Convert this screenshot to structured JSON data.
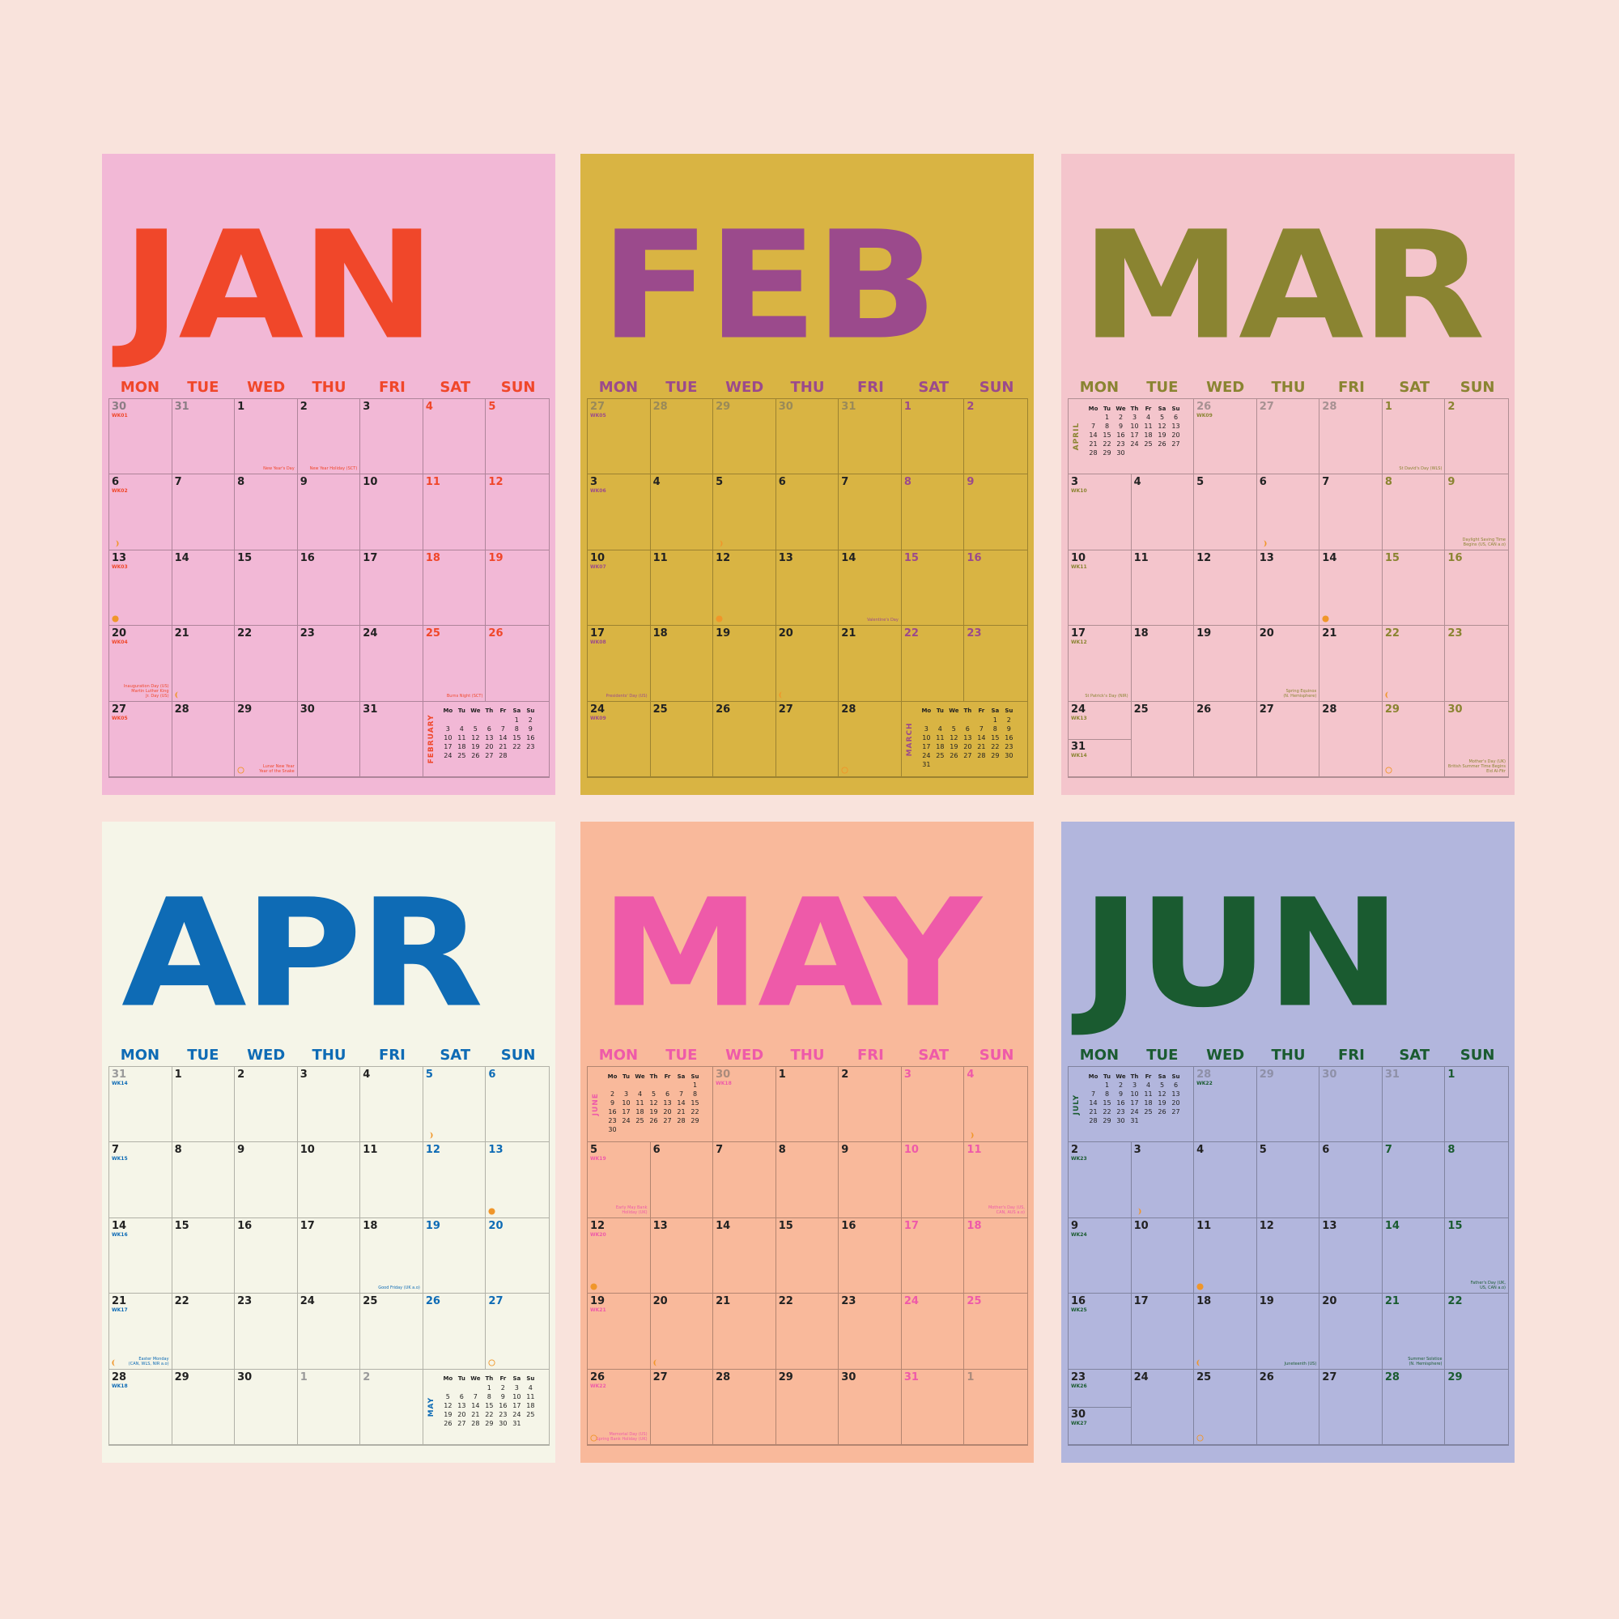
{
  "dow": [
    "MON",
    "TUE",
    "WED",
    "THU",
    "FRI",
    "SAT",
    "SUN"
  ],
  "mini_dow": [
    "Mo",
    "Tu",
    "We",
    "Th",
    "Fr",
    "Sa",
    "Su"
  ],
  "colors": {
    "background": "#f9e3dc",
    "moon": "#f0962a"
  },
  "months": [
    {
      "title": "JAN",
      "bg": "#f2b8d6",
      "accent": "#f0472a",
      "dim": "#8c7d85",
      "cells": [
        {
          "n": "30",
          "dim": true,
          "wk": "WK01"
        },
        {
          "n": "31",
          "dim": true
        },
        {
          "n": "1",
          "note": "New Year's Day"
        },
        {
          "n": "2",
          "note": "New Year Holiday (SCT)"
        },
        {
          "n": "3"
        },
        {
          "n": "4",
          "we": true
        },
        {
          "n": "5",
          "we": true
        },
        {
          "n": "6",
          "wk": "WK02",
          "moon": "first"
        },
        {
          "n": "7"
        },
        {
          "n": "8"
        },
        {
          "n": "9"
        },
        {
          "n": "10"
        },
        {
          "n": "11",
          "we": true
        },
        {
          "n": "12",
          "we": true
        },
        {
          "n": "13",
          "wk": "WK03",
          "moon": "full"
        },
        {
          "n": "14"
        },
        {
          "n": "15"
        },
        {
          "n": "16"
        },
        {
          "n": "17"
        },
        {
          "n": "18",
          "we": true
        },
        {
          "n": "19",
          "we": true
        },
        {
          "n": "20",
          "wk": "WK04",
          "note": "Inauguration Day (US)\nMartin Luther King\nJr. Day (US)"
        },
        {
          "n": "21",
          "moon": "last"
        },
        {
          "n": "22"
        },
        {
          "n": "23"
        },
        {
          "n": "24"
        },
        {
          "n": "25",
          "we": true,
          "note": "Burns Night (SCT)"
        },
        {
          "n": "26",
          "we": true
        },
        {
          "n": "27",
          "wk": "WK05"
        },
        {
          "n": "28"
        },
        {
          "n": "29",
          "moon": "new",
          "note": "Lunar New Year\nYear of the Snake"
        },
        {
          "n": "30"
        },
        {
          "n": "31"
        },
        {
          "mini": 1,
          "span": 2
        }
      ],
      "mini": {
        "name": "FEBRUARY",
        "rows": [
          [
            "",
            "",
            "",
            "",
            "",
            "1",
            "2"
          ],
          [
            "3",
            "4",
            "5",
            "6",
            "7",
            "8",
            "9"
          ],
          [
            "10",
            "11",
            "12",
            "13",
            "14",
            "15",
            "16"
          ],
          [
            "17",
            "18",
            "19",
            "20",
            "21",
            "22",
            "23"
          ],
          [
            "24",
            "25",
            "26",
            "27",
            "28",
            "",
            ""
          ]
        ]
      }
    },
    {
      "title": "FEB",
      "bg": "#d9b443",
      "accent": "#9b4a8c",
      "dim": "#9a8a58",
      "cells": [
        {
          "n": "27",
          "dim": true,
          "wk": "WK05"
        },
        {
          "n": "28",
          "dim": true
        },
        {
          "n": "29",
          "dim": true
        },
        {
          "n": "30",
          "dim": true
        },
        {
          "n": "31",
          "dim": true
        },
        {
          "n": "1",
          "we": true
        },
        {
          "n": "2",
          "we": true
        },
        {
          "n": "3",
          "wk": "WK06"
        },
        {
          "n": "4"
        },
        {
          "n": "5",
          "moon": "first"
        },
        {
          "n": "6"
        },
        {
          "n": "7"
        },
        {
          "n": "8",
          "we": true
        },
        {
          "n": "9",
          "we": true
        },
        {
          "n": "10",
          "wk": "WK07"
        },
        {
          "n": "11"
        },
        {
          "n": "12",
          "moon": "full"
        },
        {
          "n": "13"
        },
        {
          "n": "14",
          "note": "Valentine's Day"
        },
        {
          "n": "15",
          "we": true
        },
        {
          "n": "16",
          "we": true
        },
        {
          "n": "17",
          "wk": "WK08",
          "note": "Presidents' Day (US)"
        },
        {
          "n": "18"
        },
        {
          "n": "19"
        },
        {
          "n": "20",
          "moon": "last"
        },
        {
          "n": "21"
        },
        {
          "n": "22",
          "we": true
        },
        {
          "n": "23",
          "we": true
        },
        {
          "n": "24",
          "wk": "WK09"
        },
        {
          "n": "25"
        },
        {
          "n": "26"
        },
        {
          "n": "27"
        },
        {
          "n": "28",
          "moon": "new"
        },
        {
          "mini": 1,
          "span": 2
        }
      ],
      "mini": {
        "name": "MARCH",
        "rows": [
          [
            "",
            "",
            "",
            "",
            "",
            "1",
            "2"
          ],
          [
            "3",
            "4",
            "5",
            "6",
            "7",
            "8",
            "9"
          ],
          [
            "10",
            "11",
            "12",
            "13",
            "14",
            "15",
            "16"
          ],
          [
            "17",
            "18",
            "19",
            "20",
            "21",
            "22",
            "23"
          ],
          [
            "24",
            "25",
            "26",
            "27",
            "28",
            "29",
            "30"
          ],
          [
            "31",
            "",
            "",
            "",
            "",
            "",
            ""
          ]
        ]
      }
    },
    {
      "title": "MAR",
      "bg": "#f4c5cc",
      "accent": "#8a8431",
      "dim": "#a79192",
      "cells": [
        {
          "mini": 1,
          "span": 2
        },
        {
          "n": "26",
          "dim": true,
          "wk": "WK09"
        },
        {
          "n": "27",
          "dim": true
        },
        {
          "n": "28",
          "dim": true
        },
        {
          "n": "1",
          "we": true,
          "note": "St David's Day (WLS)"
        },
        {
          "n": "2",
          "we": true
        },
        {
          "n": "3",
          "wk": "WK10"
        },
        {
          "n": "4"
        },
        {
          "n": "5"
        },
        {
          "n": "6",
          "moon": "first"
        },
        {
          "n": "7"
        },
        {
          "n": "8",
          "we": true
        },
        {
          "n": "9",
          "we": true,
          "note": "Daylight Saving Time\nBegins (US, CAN a.o)"
        },
        {
          "n": "10",
          "wk": "WK11"
        },
        {
          "n": "11"
        },
        {
          "n": "12"
        },
        {
          "n": "13"
        },
        {
          "n": "14",
          "moon": "full"
        },
        {
          "n": "15",
          "we": true
        },
        {
          "n": "16",
          "we": true
        },
        {
          "n": "17",
          "wk": "WK12",
          "note": "St Patrick's Day (NIR)"
        },
        {
          "n": "18"
        },
        {
          "n": "19"
        },
        {
          "n": "20",
          "note": "Spring Equinox\n(N. Hemisphere)"
        },
        {
          "n": "21"
        },
        {
          "n": "22",
          "we": true,
          "moon": "last"
        },
        {
          "n": "23",
          "we": true
        },
        {
          "n": "24",
          "wk": "WK13",
          "split": {
            "n": "31",
            "wk": "WK14"
          }
        },
        {
          "n": "25"
        },
        {
          "n": "26"
        },
        {
          "n": "27"
        },
        {
          "n": "28"
        },
        {
          "n": "29",
          "we": true,
          "moon": "new"
        },
        {
          "n": "30",
          "we": true,
          "note": "Mother's Day (UK)\nBritish Summer Time Begins\nEid Al-Fitr"
        }
      ],
      "mini": {
        "name": "APRIL",
        "rows": [
          [
            "",
            "1",
            "2",
            "3",
            "4",
            "5",
            "6"
          ],
          [
            "7",
            "8",
            "9",
            "10",
            "11",
            "12",
            "13"
          ],
          [
            "14",
            "15",
            "16",
            "17",
            "18",
            "19",
            "20"
          ],
          [
            "21",
            "22",
            "23",
            "24",
            "25",
            "26",
            "27"
          ],
          [
            "28",
            "29",
            "30",
            "",
            "",
            "",
            ""
          ]
        ]
      }
    },
    {
      "title": "APR",
      "bg": "#f5f5e8",
      "accent": "#0e6bb5",
      "dim": "#9a9a9a",
      "cells": [
        {
          "n": "31",
          "dim": true,
          "wk": "WK14"
        },
        {
          "n": "1"
        },
        {
          "n": "2"
        },
        {
          "n": "3"
        },
        {
          "n": "4"
        },
        {
          "n": "5",
          "we": true,
          "moon": "first"
        },
        {
          "n": "6",
          "we": true
        },
        {
          "n": "7",
          "wk": "WK15"
        },
        {
          "n": "8"
        },
        {
          "n": "9"
        },
        {
          "n": "10"
        },
        {
          "n": "11"
        },
        {
          "n": "12",
          "we": true
        },
        {
          "n": "13",
          "we": true,
          "moon": "full"
        },
        {
          "n": "14",
          "wk": "WK16"
        },
        {
          "n": "15"
        },
        {
          "n": "16"
        },
        {
          "n": "17"
        },
        {
          "n": "18",
          "note": "Good Friday (UK a.o)"
        },
        {
          "n": "19",
          "we": true
        },
        {
          "n": "20",
          "we": true
        },
        {
          "n": "21",
          "wk": "WK17",
          "moon": "last",
          "note": "Easter Monday\n(CAN, WLS, NIR a.o)"
        },
        {
          "n": "22"
        },
        {
          "n": "23"
        },
        {
          "n": "24"
        },
        {
          "n": "25"
        },
        {
          "n": "26",
          "we": true
        },
        {
          "n": "27",
          "we": true,
          "moon": "new"
        },
        {
          "n": "28",
          "wk": "WK18"
        },
        {
          "n": "29"
        },
        {
          "n": "30"
        },
        {
          "n": "1",
          "dim": true
        },
        {
          "n": "2",
          "dim": true
        },
        {
          "mini": 1,
          "span": 2
        }
      ],
      "mini": {
        "name": "MAY",
        "rows": [
          [
            "",
            "",
            "",
            "1",
            "2",
            "3",
            "4"
          ],
          [
            "5",
            "6",
            "7",
            "8",
            "9",
            "10",
            "11"
          ],
          [
            "12",
            "13",
            "14",
            "15",
            "16",
            "17",
            "18"
          ],
          [
            "19",
            "20",
            "21",
            "22",
            "23",
            "24",
            "25"
          ],
          [
            "26",
            "27",
            "28",
            "29",
            "30",
            "31",
            ""
          ]
        ]
      }
    },
    {
      "title": "MAY",
      "bg": "#f9b99b",
      "accent": "#ee5aa9",
      "dim": "#ab8b7c",
      "cells": [
        {
          "mini": 1,
          "span": 2
        },
        {
          "n": "30",
          "dim": true,
          "wk": "WK18"
        },
        {
          "n": "1"
        },
        {
          "n": "2"
        },
        {
          "n": "3",
          "we": true
        },
        {
          "n": "4",
          "we": true,
          "moon": "first"
        },
        {
          "n": "5",
          "wk": "WK19",
          "note": "Early May Bank\nHoliday (UK)"
        },
        {
          "n": "6"
        },
        {
          "n": "7"
        },
        {
          "n": "8"
        },
        {
          "n": "9"
        },
        {
          "n": "10",
          "we": true
        },
        {
          "n": "11",
          "we": true,
          "note": "Mother's Day (US,\nCAN, AUS a.o)"
        },
        {
          "n": "12",
          "wk": "WK20",
          "moon": "full"
        },
        {
          "n": "13"
        },
        {
          "n": "14"
        },
        {
          "n": "15"
        },
        {
          "n": "16"
        },
        {
          "n": "17",
          "we": true
        },
        {
          "n": "18",
          "we": true
        },
        {
          "n": "19",
          "wk": "WK21"
        },
        {
          "n": "20",
          "moon": "last"
        },
        {
          "n": "21"
        },
        {
          "n": "22"
        },
        {
          "n": "23"
        },
        {
          "n": "24",
          "we": true
        },
        {
          "n": "25",
          "we": true
        },
        {
          "n": "26",
          "wk": "WK22",
          "moon": "new",
          "note": "Memorial Day (US)\nSpring Bank Holiday (UK)"
        },
        {
          "n": "27"
        },
        {
          "n": "28"
        },
        {
          "n": "29"
        },
        {
          "n": "30"
        },
        {
          "n": "31",
          "we": true
        },
        {
          "n": "1",
          "dim": true
        }
      ],
      "mini": {
        "name": "JUNE",
        "rows": [
          [
            "",
            "",
            "",
            "",
            "",
            "",
            "1"
          ],
          [
            "2",
            "3",
            "4",
            "5",
            "6",
            "7",
            "8"
          ],
          [
            "9",
            "10",
            "11",
            "12",
            "13",
            "14",
            "15"
          ],
          [
            "16",
            "17",
            "18",
            "19",
            "20",
            "21",
            "22"
          ],
          [
            "23",
            "24",
            "25",
            "26",
            "27",
            "28",
            "29"
          ],
          [
            "30",
            "",
            "",
            "",
            "",
            "",
            ""
          ]
        ]
      }
    },
    {
      "title": "JUN",
      "bg": "#b2b6dd",
      "accent": "#1a5b30",
      "dim": "#8e90a8",
      "cells": [
        {
          "mini": 1,
          "span": 2
        },
        {
          "n": "28",
          "dim": true,
          "wk": "WK22"
        },
        {
          "n": "29",
          "dim": true
        },
        {
          "n": "30",
          "dim": true
        },
        {
          "n": "31",
          "dim": true
        },
        {
          "n": "1",
          "we": true
        },
        {
          "n": "2",
          "wk": "WK23"
        },
        {
          "n": "3",
          "moon": "first"
        },
        {
          "n": "4"
        },
        {
          "n": "5"
        },
        {
          "n": "6"
        },
        {
          "n": "7",
          "we": true
        },
        {
          "n": "8",
          "we": true
        },
        {
          "n": "9",
          "wk": "WK24"
        },
        {
          "n": "10"
        },
        {
          "n": "11",
          "moon": "full"
        },
        {
          "n": "12"
        },
        {
          "n": "13"
        },
        {
          "n": "14",
          "we": true
        },
        {
          "n": "15",
          "we": true,
          "note": "Father's Day (UK,\nUS, CAN a.o)"
        },
        {
          "n": "16",
          "wk": "WK25"
        },
        {
          "n": "17"
        },
        {
          "n": "18",
          "moon": "last"
        },
        {
          "n": "19",
          "note": "Juneteenth (US)"
        },
        {
          "n": "20"
        },
        {
          "n": "21",
          "we": true,
          "note": "Summer Solstice\n(N. Hemisphere)"
        },
        {
          "n": "22",
          "we": true
        },
        {
          "n": "23",
          "wk": "WK26",
          "split": {
            "n": "30",
            "wk": "WK27"
          }
        },
        {
          "n": "24"
        },
        {
          "n": "25",
          "moon": "new"
        },
        {
          "n": "26"
        },
        {
          "n": "27"
        },
        {
          "n": "28",
          "we": true
        },
        {
          "n": "29",
          "we": true
        }
      ],
      "mini": {
        "name": "JULY",
        "rows": [
          [
            "",
            "1",
            "2",
            "3",
            "4",
            "5",
            "6"
          ],
          [
            "7",
            "8",
            "9",
            "10",
            "11",
            "12",
            "13"
          ],
          [
            "14",
            "15",
            "16",
            "17",
            "18",
            "19",
            "20"
          ],
          [
            "21",
            "22",
            "23",
            "24",
            "25",
            "26",
            "27"
          ],
          [
            "28",
            "29",
            "30",
            "31",
            "",
            "",
            ""
          ]
        ]
      }
    }
  ]
}
